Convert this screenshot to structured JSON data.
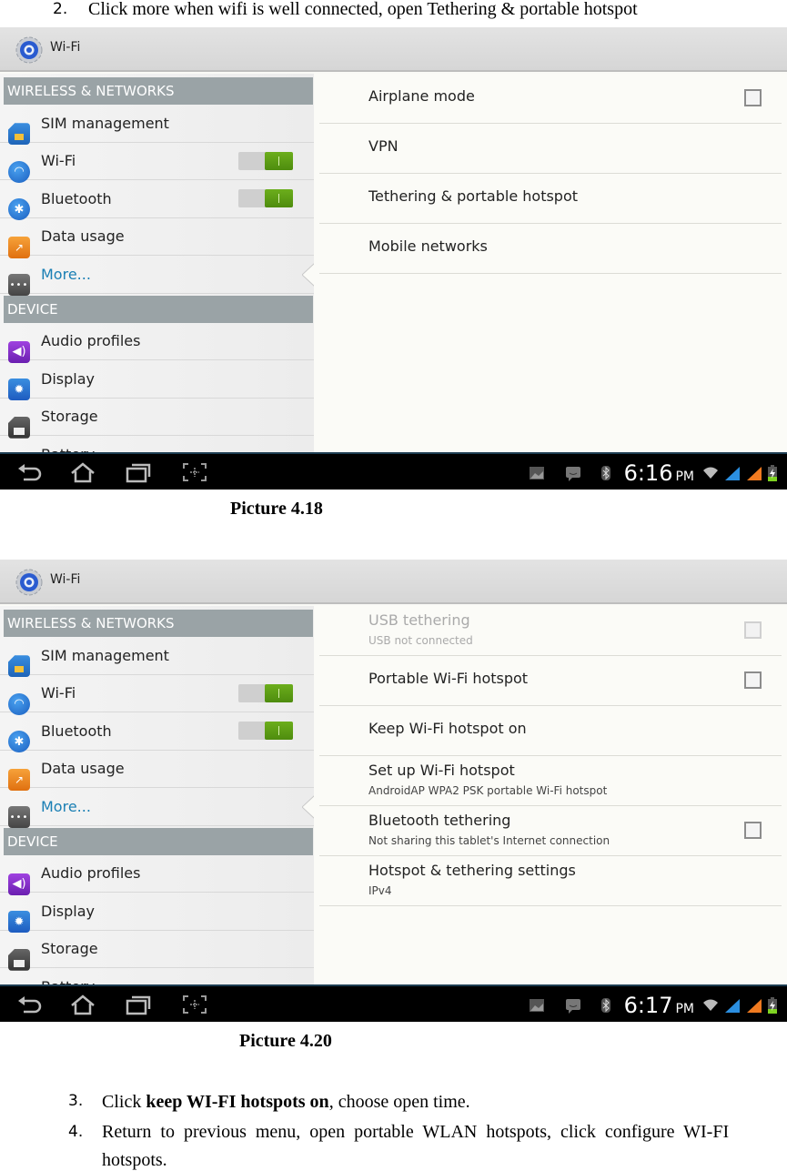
{
  "intro": {
    "number": "2.",
    "text": "Click more when wifi is well connected, open Tethering & portable hotspot"
  },
  "screens": [
    {
      "caption": "Picture 4.18",
      "actionbar_title": "Wi-Fi",
      "left": {
        "section1": "WIRELESS & NETWORKS",
        "items1": [
          {
            "label": "SIM management",
            "icon": "sim-card-icon"
          },
          {
            "label": "Wi-Fi",
            "icon": "wifi-icon",
            "toggle": "on"
          },
          {
            "label": "Bluetooth",
            "icon": "bluetooth-icon",
            "toggle": "on"
          },
          {
            "label": "Data usage",
            "icon": "data-usage-icon"
          },
          {
            "label": "More...",
            "icon": "more-icon",
            "selected": true
          }
        ],
        "section2": "DEVICE",
        "items2": [
          {
            "label": "Audio profiles",
            "icon": "audio-icon"
          },
          {
            "label": "Display",
            "icon": "display-icon"
          },
          {
            "label": "Storage",
            "icon": "storage-icon"
          },
          {
            "label": "Battery",
            "icon": "battery-icon"
          }
        ]
      },
      "right": [
        {
          "title": "Airplane mode",
          "checkbox": "unchecked"
        },
        {
          "title": "VPN"
        },
        {
          "title": "Tethering & portable hotspot"
        },
        {
          "title": "Mobile networks"
        }
      ],
      "status": {
        "time": "6:16",
        "ampm": "PM"
      }
    },
    {
      "caption": "Picture 4.20",
      "actionbar_title": "Wi-Fi",
      "left": {
        "section1": "WIRELESS & NETWORKS",
        "items1": [
          {
            "label": "SIM management",
            "icon": "sim-card-icon"
          },
          {
            "label": "Wi-Fi",
            "icon": "wifi-icon",
            "toggle": "on"
          },
          {
            "label": "Bluetooth",
            "icon": "bluetooth-icon",
            "toggle": "on"
          },
          {
            "label": "Data usage",
            "icon": "data-usage-icon"
          },
          {
            "label": "More...",
            "icon": "more-icon",
            "selected": true
          }
        ],
        "section2": "DEVICE",
        "items2": [
          {
            "label": "Audio profiles",
            "icon": "audio-icon"
          },
          {
            "label": "Display",
            "icon": "display-icon"
          },
          {
            "label": "Storage",
            "icon": "storage-icon"
          },
          {
            "label": "Battery",
            "icon": "battery-icon"
          }
        ]
      },
      "right": [
        {
          "title": "USB tethering",
          "subtitle": "USB not connected",
          "checkbox": "disabled"
        },
        {
          "title": "Portable Wi-Fi hotspot",
          "checkbox": "unchecked"
        },
        {
          "title": "Keep Wi-Fi hotspot on"
        },
        {
          "title": "Set up Wi-Fi hotspot",
          "subtitle": "AndroidAP WPA2 PSK portable Wi-Fi hotspot"
        },
        {
          "title": "Bluetooth tethering",
          "subtitle": "Not sharing this tablet's Internet connection",
          "checkbox": "unchecked"
        },
        {
          "title": "Hotspot & tethering settings",
          "subtitle": "IPv4"
        }
      ],
      "status": {
        "time": "6:17",
        "ampm": "PM"
      }
    }
  ],
  "steps": [
    {
      "number": "3.",
      "prefix": "Click ",
      "bold": "keep WI-FI hotspots on",
      "suffix": ", choose open time."
    },
    {
      "number": "4.",
      "line1": "Return  to  previous  menu,  open  portable  WLAN  hotspots,  click  configure  WI-FI",
      "line2": "hotspots."
    }
  ],
  "colors": {
    "toggle_on": "#5c9e14",
    "selected_item": "#1a7fb4",
    "section_header": "#9aa3a6",
    "navbar": "#000000"
  }
}
